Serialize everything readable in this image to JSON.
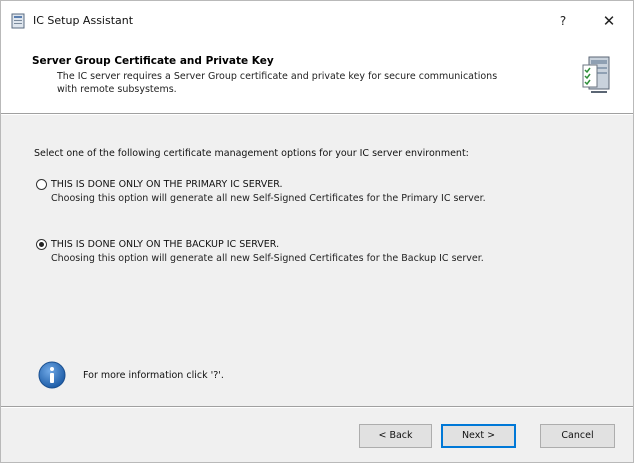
{
  "window": {
    "title": "IC Setup Assistant",
    "help_label": "?",
    "close_label": "✕"
  },
  "header": {
    "title": "Server Group Certificate and Private Key",
    "description": "The IC server requires a Server Group certificate and private key for secure communications with remote subsystems."
  },
  "body": {
    "prompt": "Select one of the following certificate management options for your IC server environment:",
    "options": [
      {
        "label": "THIS IS DONE ONLY ON THE PRIMARY IC SERVER.",
        "description": "Choosing this option will generate all new Self-Signed Certificates for the Primary IC server.",
        "selected": false
      },
      {
        "label": "THIS IS DONE ONLY ON THE BACKUP IC SERVER.",
        "description": "Choosing this option will generate all new Self-Signed Certificates for the Backup IC server.",
        "selected": true
      }
    ],
    "info_text": "For more information click '?'."
  },
  "footer": {
    "back_label": "< Back",
    "next_label": "Next >",
    "cancel_label": "Cancel"
  },
  "colors": {
    "accent": "#0078d7",
    "info_icon": "#2a6ebb",
    "dialog_bg": "#f0f0f0"
  },
  "icons": {
    "app": "setup-app-icon",
    "header": "server-checklist-icon",
    "info": "info-icon"
  }
}
